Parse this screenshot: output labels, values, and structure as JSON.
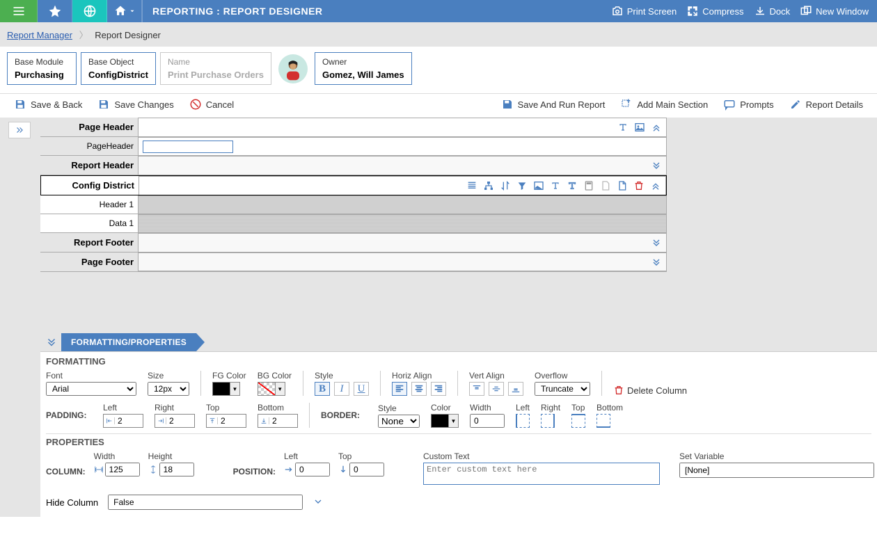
{
  "topbar": {
    "title": "REPORTING : REPORT DESIGNER",
    "actions": {
      "print_screen": "Print Screen",
      "compress": "Compress",
      "dock": "Dock",
      "new_window": "New Window"
    }
  },
  "breadcrumb": {
    "manager": "Report Manager",
    "designer": "Report Designer"
  },
  "cards": {
    "base_module": {
      "label": "Base Module",
      "value": "Purchasing"
    },
    "base_object": {
      "label": "Base Object",
      "value": "ConfigDistrict"
    },
    "name": {
      "label": "Name",
      "value": "Print Purchase Orders"
    },
    "owner": {
      "label": "Owner",
      "value": "Gomez, Will James"
    }
  },
  "toolbar": {
    "save_back": "Save & Back",
    "save_changes": "Save Changes",
    "cancel": "Cancel",
    "save_run": "Save And Run Report",
    "add_main": "Add Main Section",
    "prompts": "Prompts",
    "report_details": "Report Details"
  },
  "bands": {
    "page_header": "Page Header",
    "page_header_sub": "PageHeader",
    "report_header": "Report Header",
    "config_district": "Config District",
    "header1": "Header 1",
    "data1": "Data 1",
    "report_footer": "Report Footer",
    "page_footer": "Page Footer"
  },
  "tab": {
    "formatting_properties": "FORMATTING/PROPERTIES"
  },
  "formatting": {
    "heading": "FORMATTING",
    "font_label": "Font",
    "font_value": "Arial",
    "size_label": "Size",
    "size_value": "12px",
    "fg_label": "FG Color",
    "fg_value": "#000000",
    "bg_label": "BG Color",
    "style_label": "Style",
    "horiz_label": "Horiz Align",
    "vert_label": "Vert Align",
    "overflow_label": "Overflow",
    "overflow_value": "Truncate",
    "delete_col": "Delete Column",
    "padding_label": "PADDING:",
    "padding_left": "Left",
    "padding_right": "Right",
    "padding_top": "Top",
    "padding_bottom": "Bottom",
    "pad_left_v": "2",
    "pad_right_v": "2",
    "pad_top_v": "2",
    "pad_bottom_v": "2",
    "border_label": "BORDER:",
    "border_style_label": "Style",
    "border_style_value": "None",
    "border_color_label": "Color",
    "border_color_value": "#000000",
    "border_width_label": "Width",
    "border_width_value": "0",
    "border_left": "Left",
    "border_right": "Right",
    "border_top": "Top",
    "border_bottom": "Bottom"
  },
  "properties": {
    "heading": "PROPERTIES",
    "column_label": "COLUMN:",
    "width_label": "Width",
    "width_value": "125",
    "height_label": "Height",
    "height_value": "18",
    "position_label": "POSITION:",
    "left_label": "Left",
    "left_value": "0",
    "top_label": "Top",
    "top_value": "0",
    "custom_text_label": "Custom Text",
    "custom_text_placeholder": "Enter custom text here",
    "set_variable_label": "Set Variable",
    "set_variable_value": "[None]",
    "hide_col_label": "Hide Column",
    "hide_col_value": "False"
  }
}
